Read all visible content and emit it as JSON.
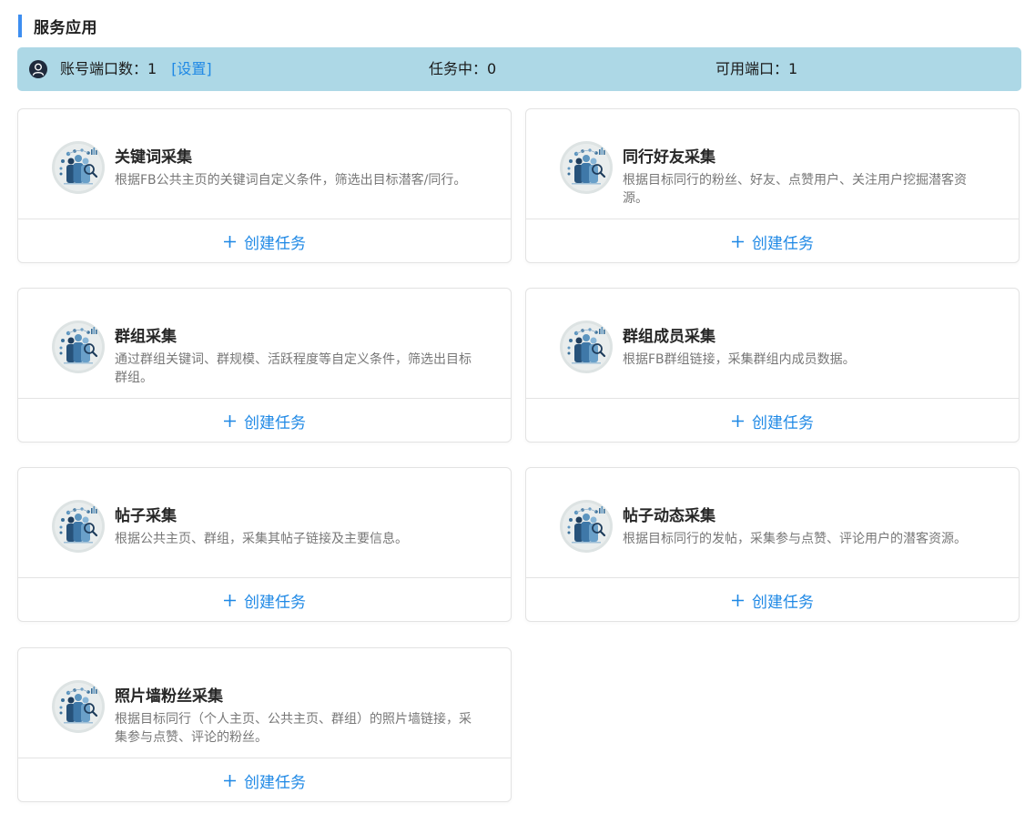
{
  "section": {
    "title": "服务应用"
  },
  "info_bar": {
    "avatar_icon": "user-circle-icon",
    "account_ports_label": "账号端口数：1",
    "settings_link": "[设置]",
    "tasks_label": "任务中：0",
    "available_ports_label": "可用端口：1"
  },
  "cards": [
    {
      "title": "关键词采集",
      "description": "根据FB公共主页的关键词自定义条件，筛选出目标潜客/同行。",
      "action": "创建任务"
    },
    {
      "title": "同行好友采集",
      "description": "根据目标同行的粉丝、好友、点赞用户、关注用户挖掘潜客资源。",
      "action": "创建任务"
    },
    {
      "title": "群组采集",
      "description": "通过群组关键词、群规模、活跃程度等自定义条件，筛选出目标群组。",
      "action": "创建任务"
    },
    {
      "title": "群组成员采集",
      "description": "根据FB群组链接，采集群组内成员数据。",
      "action": "创建任务"
    },
    {
      "title": "帖子采集",
      "description": "根据公共主页、群组，采集其帖子链接及主要信息。",
      "action": "创建任务"
    },
    {
      "title": "帖子动态采集",
      "description": "根据目标同行的发帖，采集参与点赞、评论用户的潜客资源。",
      "action": "创建任务"
    },
    {
      "title": "照片墙粉丝采集",
      "description": "根据目标同行（个人主页、公共主页、群组）的照片墙链接，采集参与点赞、评论的粉丝。",
      "action": "创建任务"
    }
  ],
  "colors": {
    "accent": "#1e88e5",
    "info_bar_bg": "#add8e6",
    "title_bar": "#3d8ef0"
  }
}
